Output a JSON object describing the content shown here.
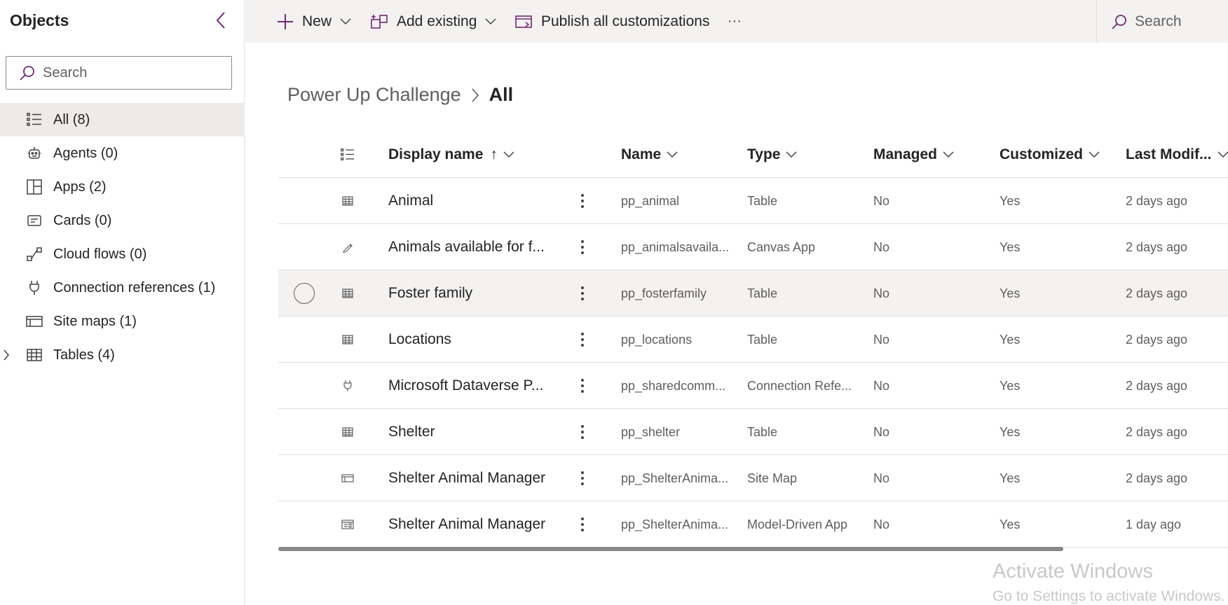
{
  "left_panel": {
    "title": "Objects",
    "search_placeholder": "Search",
    "items": [
      {
        "label": "All  (8)",
        "icon": "list-icon"
      },
      {
        "label": "Agents  (0)",
        "icon": "bot-icon"
      },
      {
        "label": "Apps  (2)",
        "icon": "apps-icon"
      },
      {
        "label": "Cards  (0)",
        "icon": "card-icon"
      },
      {
        "label": "Cloud flows  (0)",
        "icon": "flow-icon"
      },
      {
        "label": "Connection references  (1)",
        "icon": "plug-icon"
      },
      {
        "label": "Site maps  (1)",
        "icon": "sitemap-icon"
      },
      {
        "label": "Tables  (4)",
        "icon": "table-icon"
      }
    ]
  },
  "command_bar": {
    "new_label": "New",
    "add_existing_label": "Add existing",
    "publish_label": "Publish all customizations",
    "more_label": "···",
    "search_label": "Search"
  },
  "breadcrumb": {
    "parent": "Power Up Challenge",
    "current": "All"
  },
  "grid": {
    "columns": {
      "display_name": "Display name",
      "sort_arrow": "↑",
      "name": "Name",
      "type": "Type",
      "managed": "Managed",
      "customized": "Customized",
      "last_modified": "Last Modif..."
    },
    "rows": [
      {
        "display_name": "Animal",
        "name": "pp_animal",
        "type": "Table",
        "managed": "No",
        "customized": "Yes",
        "last_modified": "2 days ago",
        "icon": "table-icon"
      },
      {
        "display_name": "Animals available for f...",
        "name": "pp_animalsavaila...",
        "type": "Canvas App",
        "managed": "No",
        "customized": "Yes",
        "last_modified": "2 days ago",
        "icon": "pen-icon"
      },
      {
        "display_name": "Foster family",
        "name": "pp_fosterfamily",
        "type": "Table",
        "managed": "No",
        "customized": "Yes",
        "last_modified": "2 days ago",
        "icon": "table-icon"
      },
      {
        "display_name": "Locations",
        "name": "pp_locations",
        "type": "Table",
        "managed": "No",
        "customized": "Yes",
        "last_modified": "2 days ago",
        "icon": "table-icon"
      },
      {
        "display_name": "Microsoft Dataverse P...",
        "name": "pp_sharedcomm...",
        "type": "Connection Refe...",
        "managed": "No",
        "customized": "Yes",
        "last_modified": "2 days ago",
        "icon": "plug-icon"
      },
      {
        "display_name": "Shelter",
        "name": "pp_shelter",
        "type": "Table",
        "managed": "No",
        "customized": "Yes",
        "last_modified": "2 days ago",
        "icon": "table-icon"
      },
      {
        "display_name": "Shelter Animal Manager",
        "name": "pp_ShelterAnima...",
        "type": "Site Map",
        "managed": "No",
        "customized": "Yes",
        "last_modified": "2 days ago",
        "icon": "sitemap-icon"
      },
      {
        "display_name": "Shelter Animal Manager",
        "name": "pp_ShelterAnima...",
        "type": "Model-Driven App",
        "managed": "No",
        "customized": "Yes",
        "last_modified": "1 day ago",
        "icon": "app-icon"
      }
    ]
  },
  "watermark": {
    "line1": "Activate Windows",
    "line2": "Go to Settings to activate Windows."
  },
  "colors": {
    "accent": "#742774",
    "selected_bg": "#edebe9",
    "command_bar_bg": "#f3f2f1"
  }
}
